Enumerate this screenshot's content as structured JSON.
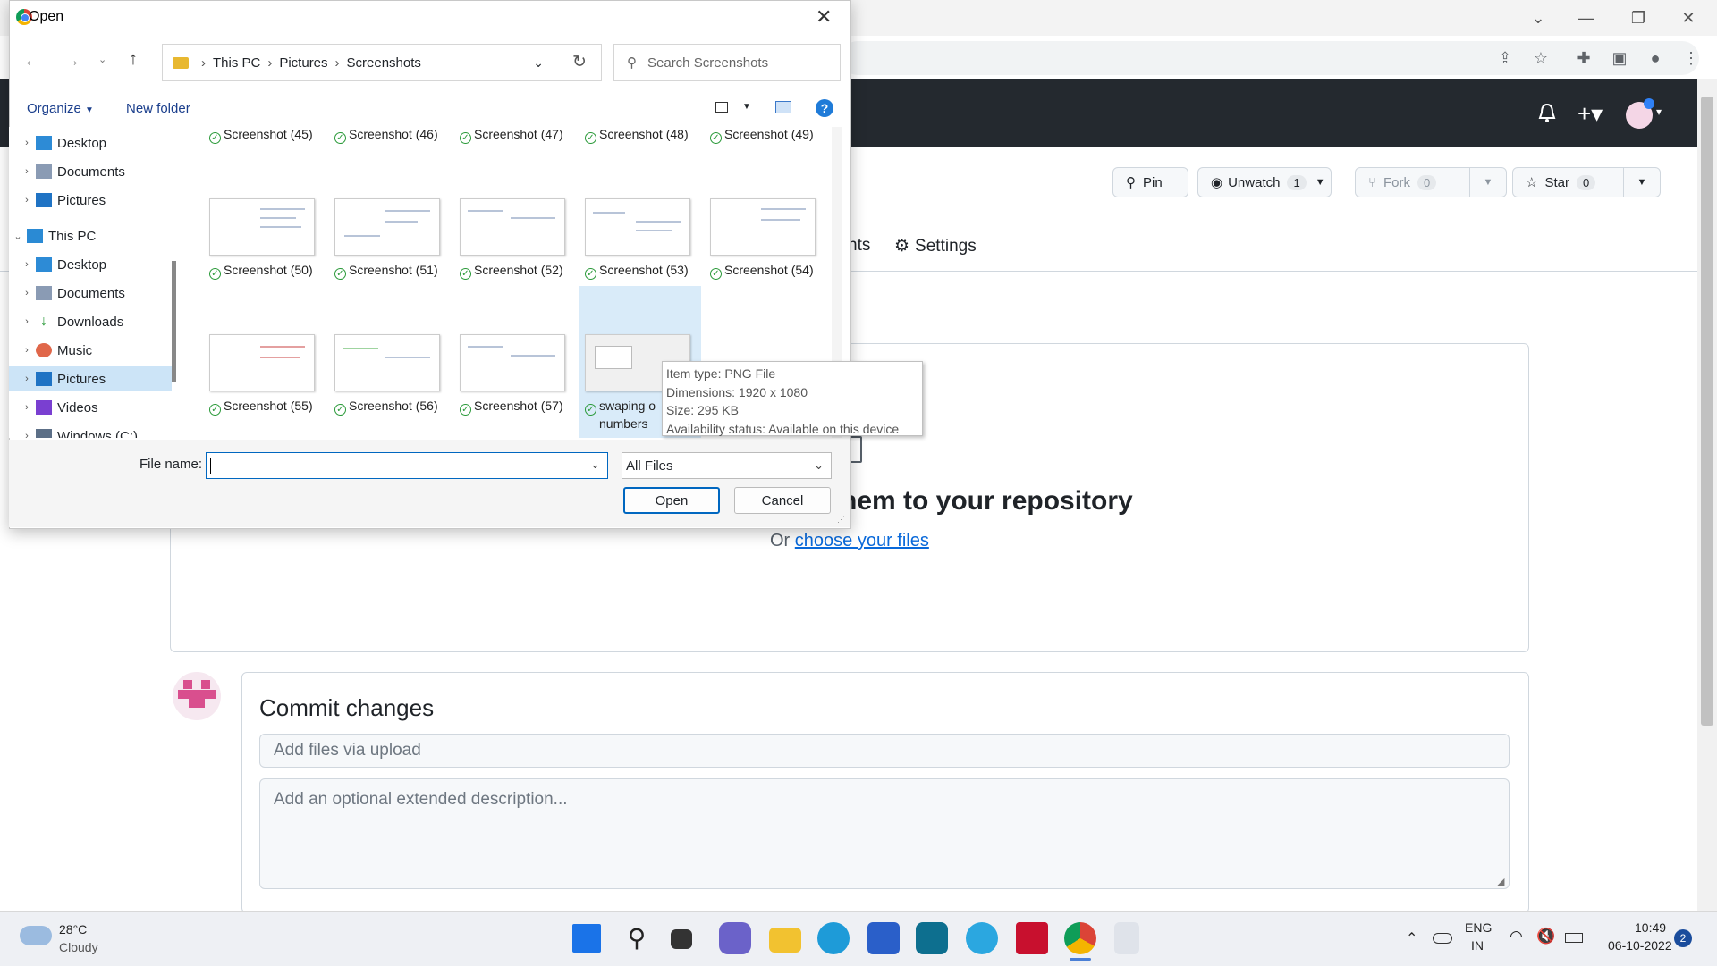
{
  "dialog": {
    "title": "Open",
    "address": [
      "This PC",
      "Pictures",
      "Screenshots"
    ],
    "search_placeholder": "Search Screenshots",
    "organize": "Organize",
    "new_folder": "New folder",
    "nav": {
      "desktop": "Desktop",
      "documents": "Documents",
      "pictures": "Pictures",
      "this_pc": "This PC",
      "desktop2": "Desktop",
      "documents2": "Documents",
      "downloads": "Downloads",
      "music": "Music",
      "pictures2": "Pictures",
      "videos": "Videos",
      "windows_c": "Windows (C:)"
    },
    "files": {
      "f45": "Screenshot (45)",
      "f46": "Screenshot (46)",
      "f47": "Screenshot (47)",
      "f48": "Screenshot (48)",
      "f49": "Screenshot (49)",
      "f50": "Screenshot (50)",
      "f51": "Screenshot (51)",
      "f52": "Screenshot (52)",
      "f53": "Screenshot (53)",
      "f54": "Screenshot (54)",
      "f55": "Screenshot (55)",
      "f56": "Screenshot (56)",
      "f57": "Screenshot (57)",
      "swap_line1": "swaping o",
      "swap_line2": "numbers"
    },
    "tooltip": {
      "type": "Item type: PNG File",
      "dims": "Dimensions: 1920 x 1080",
      "size": "Size: 295 KB",
      "avail": "Availability status: Available on this device"
    },
    "file_name_label": "File name:",
    "file_name_value": "",
    "file_type": "All Files",
    "open_btn": "Open",
    "cancel_btn": "Cancel"
  },
  "repo": {
    "pin": "Pin",
    "unwatch": "Unwatch",
    "unwatch_count": "1",
    "fork": "Fork",
    "fork_count": "0",
    "star": "Star",
    "star_count": "0",
    "tab_partial": "nts",
    "settings": "Settings"
  },
  "upload": {
    "drag_text": "hem to your repository",
    "or": "Or",
    "choose": "choose your files"
  },
  "commit": {
    "title": "Commit changes",
    "summary_placeholder": "Add files via upload",
    "desc_placeholder": "Add an optional extended description..."
  },
  "taskbar": {
    "temp": "28°C",
    "weather": "Cloudy",
    "lang1": "ENG",
    "lang2": "IN",
    "time": "10:49",
    "date": "06-10-2022",
    "notif": "2"
  },
  "colors": {
    "gh_header": "#24292f",
    "accent_blue": "#0067c0",
    "link": "#0969da"
  }
}
